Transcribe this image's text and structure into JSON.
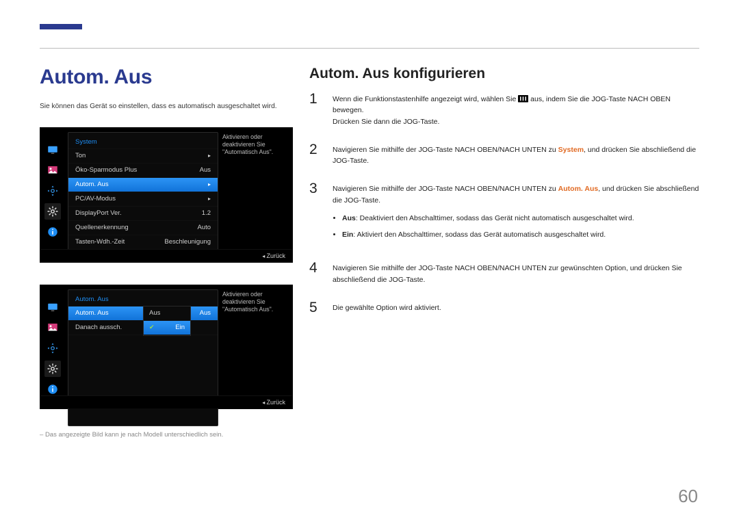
{
  "page_number": "60",
  "left": {
    "title": "Autom. Aus",
    "intro": "Sie können das Gerät so einstellen, dass es automatisch ausgeschaltet wird.",
    "footnote": "Das angezeigte Bild kann je nach Modell unterschiedlich sein."
  },
  "osd1": {
    "heading": "System",
    "tip": "Aktivieren oder deaktivieren Sie \"Automatisch Aus\".",
    "back": "Zurück",
    "rows": [
      {
        "label": "Ton",
        "value": "▸"
      },
      {
        "label": "Öko-Sparmodus Plus",
        "value": "Aus"
      },
      {
        "label": "Autom. Aus",
        "value": "▸",
        "hl": true
      },
      {
        "label": "PC/AV-Modus",
        "value": "▸"
      },
      {
        "label": "DisplayPort Ver.",
        "value": "1.2"
      },
      {
        "label": "Quellenerkennung",
        "value": "Auto"
      },
      {
        "label": "Tasten-Wdh.-Zeit",
        "value": "Beschleunigung"
      }
    ]
  },
  "osd2": {
    "heading": "Autom. Aus",
    "tip": "Aktivieren oder deaktivieren Sie \"Automatisch Aus\".",
    "back": "Zurück",
    "rows": [
      {
        "label": "Autom. Aus",
        "value": "Aus",
        "hl": true
      },
      {
        "label": "Danach aussch.",
        "value": ""
      }
    ],
    "popup": [
      {
        "label": "Aus"
      },
      {
        "label": "Ein",
        "hl": true,
        "chk": true
      }
    ]
  },
  "right": {
    "subtitle": "Autom. Aus konfigurieren",
    "steps": {
      "s1a": "Wenn die Funktionstastenhilfe angezeigt wird, wählen Sie ",
      "s1b": " aus, indem Sie die JOG-Taste NACH OBEN bewegen.",
      "s1c": "Drücken Sie dann die JOG-Taste.",
      "s2a": "Navigieren Sie mithilfe der JOG-Taste NACH OBEN/NACH UNTEN zu ",
      "s2sys": "System",
      "s2b": ", und drücken Sie abschließend die JOG-Taste.",
      "s3a": "Navigieren Sie mithilfe der JOG-Taste NACH OBEN/NACH UNTEN zu ",
      "s3auto": "Autom. Aus",
      "s3b": ", und drücken Sie abschließend die JOG-Taste.",
      "bullet1_lead": "Aus",
      "bullet1_rest": ": Deaktiviert den Abschalttimer, sodass das Gerät nicht automatisch ausgeschaltet wird.",
      "bullet2_lead": "Ein",
      "bullet2_rest": ": Aktiviert den Abschalttimer, sodass das Gerät automatisch ausgeschaltet wird.",
      "s4": "Navigieren Sie mithilfe der JOG-Taste NACH OBEN/NACH UNTEN zur gewünschten Option, und drücken Sie abschließend die JOG-Taste.",
      "s5": "Die gewählte Option wird aktiviert."
    }
  }
}
